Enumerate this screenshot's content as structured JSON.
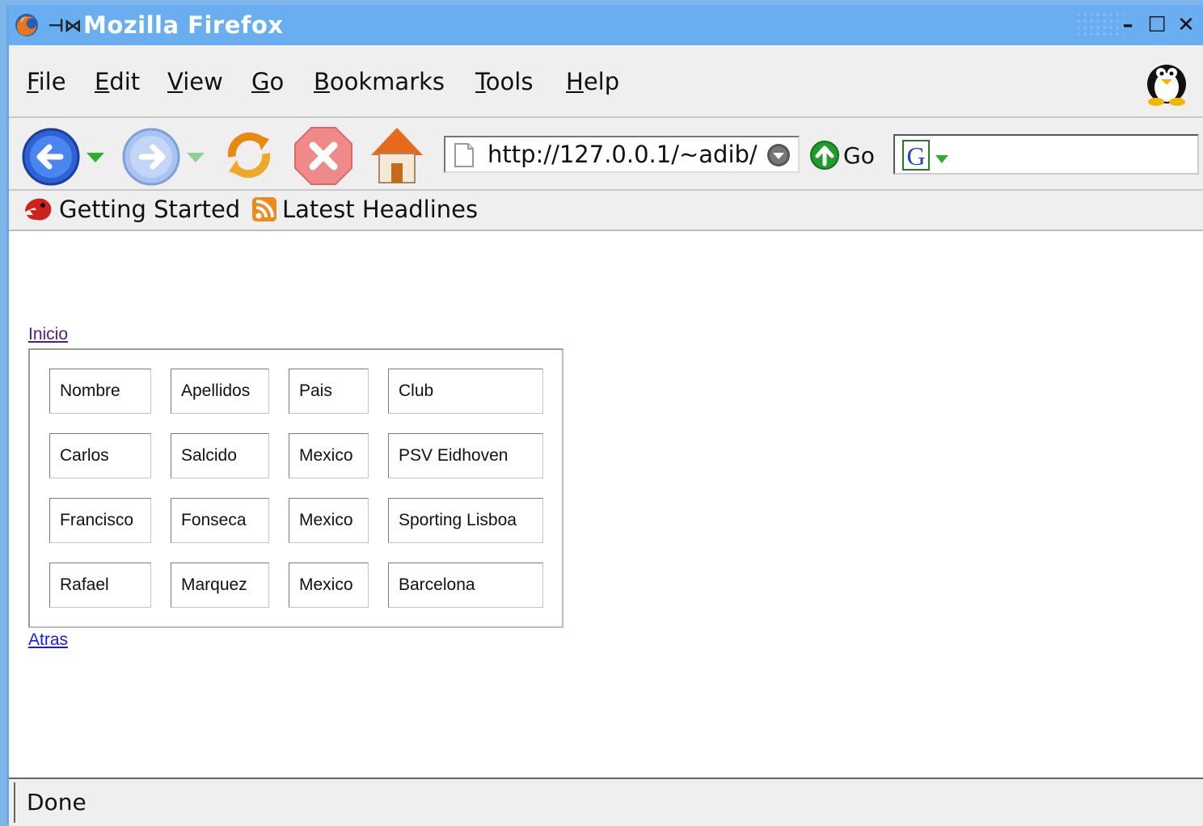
{
  "window": {
    "title": "Mozilla Firefox"
  },
  "menubar": {
    "items": [
      {
        "key": "F",
        "rest": "ile"
      },
      {
        "key": "E",
        "rest": "dit"
      },
      {
        "key": "V",
        "rest": "iew"
      },
      {
        "key": "G",
        "rest": "o"
      },
      {
        "key": "B",
        "rest": "ookmarks"
      },
      {
        "key": "T",
        "rest": "ools"
      },
      {
        "key": "H",
        "rest": "elp"
      }
    ]
  },
  "navbar": {
    "url": "http://127.0.0.1/~adib/",
    "go_label": "Go",
    "search_value": ""
  },
  "bookmarks": {
    "items": [
      {
        "label": "Getting Started"
      },
      {
        "label": "Latest Headlines"
      }
    ]
  },
  "content": {
    "top_link": "Inicio",
    "bottom_link": "Atras",
    "table": {
      "rows": [
        [
          "Nombre",
          "Apellidos",
          "Pais",
          "Club"
        ],
        [
          "Carlos",
          "Salcido",
          "Mexico",
          "PSV Eidhoven"
        ],
        [
          "Francisco",
          "Fonseca",
          "Mexico",
          "Sporting Lisboa"
        ],
        [
          "Rafael",
          "Marquez",
          "Mexico",
          "Barcelona"
        ]
      ]
    }
  },
  "statusbar": {
    "text": "Done"
  },
  "colors": {
    "titlebar": "#68aef0",
    "visited_link": "#551a8b",
    "link": "#1a1aee"
  }
}
